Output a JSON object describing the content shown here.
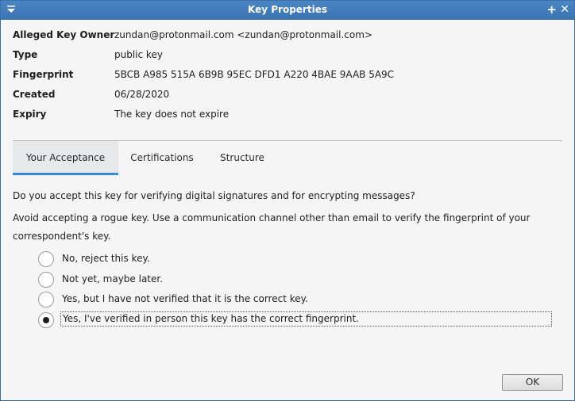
{
  "window": {
    "title": "Key Properties"
  },
  "properties": [
    {
      "label": "Alleged Key Owner",
      "value": "zundan@protonmail.com <zundan@protonmail.com>"
    },
    {
      "label": "Type",
      "value": "public key"
    },
    {
      "label": "Fingerprint",
      "value": "5BCB A985 515A 6B9B 95EC DFD1 A220 4BAE 9AAB 5A9C"
    },
    {
      "label": "Created",
      "value": "06/28/2020"
    },
    {
      "label": "Expiry",
      "value": "The key does not expire"
    }
  ],
  "tabs": [
    {
      "label": "Your Acceptance",
      "active": true
    },
    {
      "label": "Certifications",
      "active": false
    },
    {
      "label": "Structure",
      "active": false
    }
  ],
  "acceptance": {
    "question": "Do you accept this key for verifying digital signatures and for encrypting messages?",
    "warning_line1": "Avoid accepting a rogue key. Use a communication channel other than email to verify the fingerprint of your",
    "warning_line2": "correspondent's key.",
    "options": [
      {
        "label": "No, reject this key.",
        "selected": false
      },
      {
        "label": "Not yet, maybe later.",
        "selected": false
      },
      {
        "label": "Yes, but I have not verified that it is the correct key.",
        "selected": false
      },
      {
        "label": "Yes, I've verified in person this key has the correct fingerprint.",
        "selected": true
      }
    ]
  },
  "buttons": {
    "ok": "OK"
  },
  "colors": {
    "titlebar": "#3a74b3",
    "accent": "#3a88d8"
  }
}
